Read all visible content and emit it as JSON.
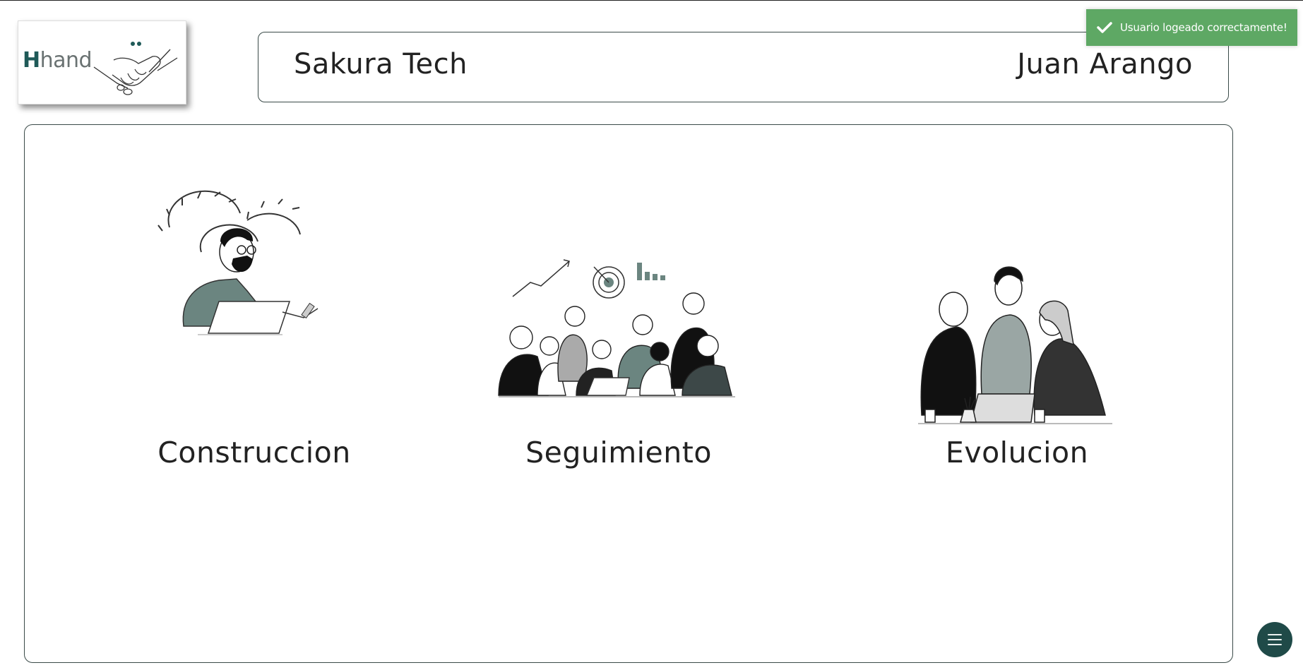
{
  "logo": {
    "letter": "H",
    "rest": "hand",
    "icon": "handshake-icon"
  },
  "header": {
    "company": "Sakura Tech",
    "user": "Juan Arango"
  },
  "toast": {
    "message": "Usuario logeado correctamente!",
    "icon": "check-icon"
  },
  "cards": [
    {
      "label": "Construccion",
      "illustration": "developer-with-gears-illustration"
    },
    {
      "label": "Seguimiento",
      "illustration": "team-meeting-illustration"
    },
    {
      "label": "Evolucion",
      "illustration": "team-collaboration-illustration"
    }
  ],
  "menu_button": {
    "icon": "hamburger-menu-icon"
  },
  "colors": {
    "accent": "#1f4a48",
    "toast": "#5ea864",
    "logo_letter": "#1f5a58",
    "illustration_fill": "#6b8580"
  }
}
